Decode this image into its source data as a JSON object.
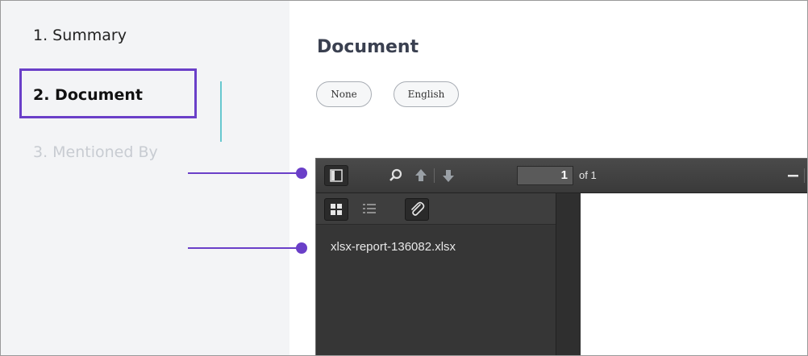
{
  "nav": {
    "items": [
      {
        "label": "1. Summary"
      },
      {
        "label": "2. Document"
      },
      {
        "label": "3. Mentioned By"
      }
    ]
  },
  "main": {
    "title": "Document",
    "tags": [
      "None",
      "English"
    ]
  },
  "viewer": {
    "page_value": "1",
    "page_total_label": "of 1",
    "attachments": [
      "xlsx-report-136082.xlsx"
    ]
  },
  "colors": {
    "accent": "#6a3fc8",
    "active_line": "#67c8cf",
    "viewer_bg": "#3b3b3b"
  }
}
